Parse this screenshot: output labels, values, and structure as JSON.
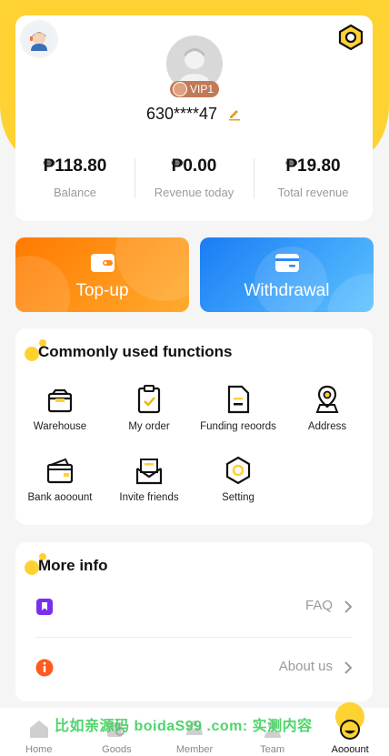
{
  "profile": {
    "phone": "630****47",
    "vip": "VIP1",
    "stats": [
      {
        "value": "₱118.80",
        "label": "Balance"
      },
      {
        "value": "₱0.00",
        "label": "Revenue today"
      },
      {
        "value": "₱19.80",
        "label": "Total revenue"
      }
    ]
  },
  "actions": {
    "topup": "Top-up",
    "withdraw": "Withdrawal"
  },
  "functions": {
    "title": "Commonly used functions",
    "items": [
      {
        "label": "Warehouse",
        "icon": "box-icon"
      },
      {
        "label": "My order",
        "icon": "clipboard-check-icon"
      },
      {
        "label": "Funding reoords",
        "icon": "document-icon"
      },
      {
        "label": "Address",
        "icon": "map-pin-icon"
      },
      {
        "label": "Bank aooount",
        "icon": "wallet-icon"
      },
      {
        "label": "Invite friends",
        "icon": "envelope-icon"
      },
      {
        "label": "Setting",
        "icon": "hexagon-icon"
      }
    ]
  },
  "more": {
    "title": "More info",
    "rows": [
      {
        "label": "FAQ",
        "icon": "bookmark-icon"
      },
      {
        "label": "About us",
        "icon": "info-icon"
      }
    ]
  },
  "tabbar": [
    {
      "label": "Home"
    },
    {
      "label": "Goods"
    },
    {
      "label": "Member"
    },
    {
      "label": "Team"
    },
    {
      "label": "Aooount"
    }
  ],
  "watermark": "比如亲源码 boidaS99 .com: 实测内容",
  "colors": {
    "accent": "#ffd233",
    "topup": "#ff7a00",
    "withdraw": "#1a7cf5"
  }
}
